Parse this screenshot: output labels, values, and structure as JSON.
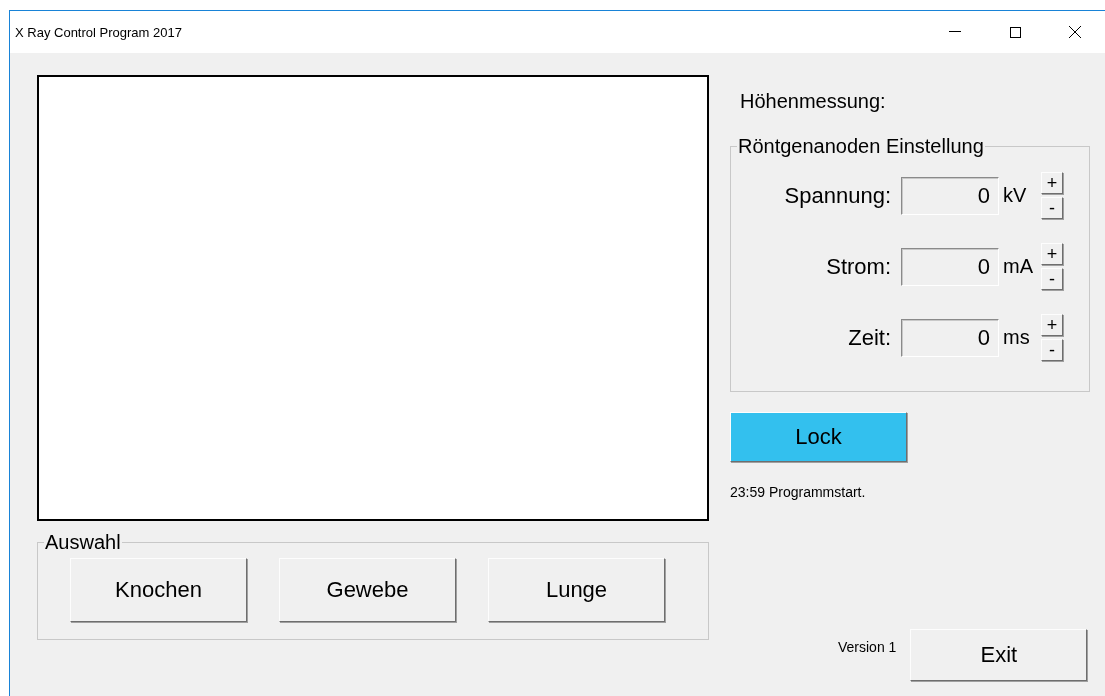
{
  "window": {
    "title": "X Ray Control Program 2017"
  },
  "height_measurement": {
    "label": "Höhenmessung:"
  },
  "anode_settings": {
    "title": "Röntgenanoden Einstellung",
    "rows": [
      {
        "label": "Spannung:",
        "value": "0",
        "unit": "kV",
        "increment": "+",
        "decrement": "-"
      },
      {
        "label": "Strom:",
        "value": "0",
        "unit": "mA",
        "increment": "+",
        "decrement": "-"
      },
      {
        "label": "Zeit:",
        "value": "0",
        "unit": "ms",
        "increment": "+",
        "decrement": "-"
      }
    ]
  },
  "lock_button": {
    "label": "Lock"
  },
  "log": [
    "23:59 Programmstart."
  ],
  "selection": {
    "title": "Auswahl",
    "buttons": [
      "Knochen",
      "Gewebe",
      "Lunge"
    ]
  },
  "version": "Version 1",
  "exit_button": {
    "label": "Exit"
  }
}
